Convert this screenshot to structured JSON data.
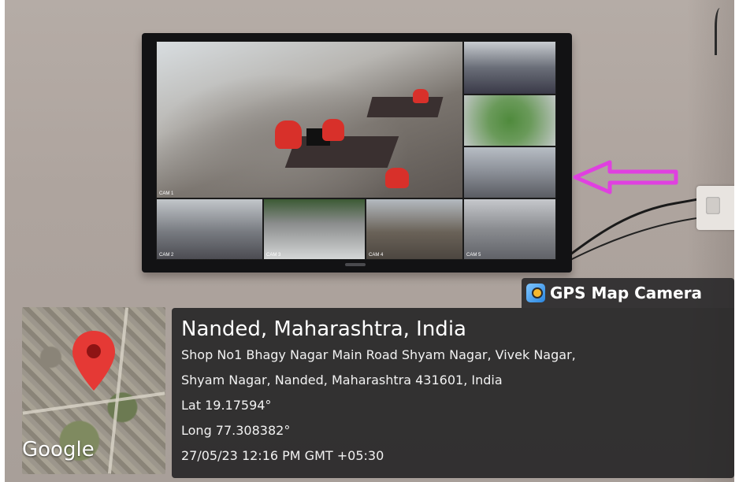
{
  "tv": {
    "camera_labels": [
      "CAM 1",
      "CAM 2",
      "CAM 3",
      "CAM 4",
      "CAM 5"
    ]
  },
  "overlay": {
    "app_name": "GPS Map Camera",
    "app_icon": "gps-map-camera-icon",
    "location_title": "Nanded, Maharashtra, India",
    "address_line_1": "Shop No1 Bhagy Nagar Main Road Shyam Nagar, Vivek Nagar,",
    "address_line_2": "Shyam Nagar, Nanded, Maharashtra 431601, India",
    "latitude": "Lat 19.17594°",
    "longitude": "Long 77.308382°",
    "timestamp": "27/05/23 12:16 PM GMT +05:30"
  },
  "map": {
    "provider_label": "Google",
    "pin_color": "#e53935"
  },
  "colors": {
    "arrow": "#e040e0",
    "panel_bg": "#1e1e20"
  }
}
